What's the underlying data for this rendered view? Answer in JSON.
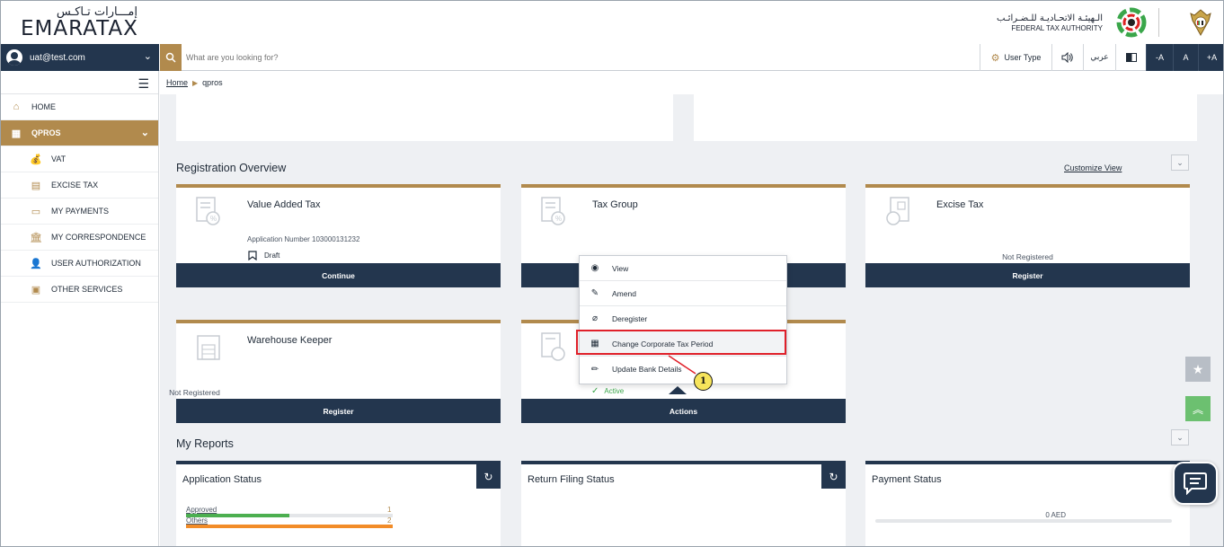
{
  "header": {
    "logo_ar": "إمـــارات تـاكـس",
    "logo_en": "EMARATAX",
    "fta_ar": "الـهيئـة الاتحـاديـة للـضـرائـب",
    "fta_en": "FEDERAL TAX AUTHORITY"
  },
  "searchbar": {
    "user_email": "uat@test.com",
    "placeholder": "What are you looking for?",
    "user_type_label": "User Type",
    "arabic_label": "عربي",
    "font_decrease": "-A",
    "font_normal": "A",
    "font_increase": "+A"
  },
  "sidebar": {
    "items": [
      {
        "label": "HOME",
        "icon": "home-icon"
      },
      {
        "label": "QPROS",
        "icon": "grid-icon"
      },
      {
        "label": "VAT",
        "icon": "money-bag-icon"
      },
      {
        "label": "EXCISE TAX",
        "icon": "excise-icon"
      },
      {
        "label": "MY PAYMENTS",
        "icon": "payments-icon"
      },
      {
        "label": "MY CORRESPONDENCE",
        "icon": "bank-icon"
      },
      {
        "label": "USER AUTHORIZATION",
        "icon": "user-auth-icon"
      },
      {
        "label": "OTHER SERVICES",
        "icon": "document-icon"
      }
    ]
  },
  "breadcrumb": {
    "home": "Home",
    "current": "qpros"
  },
  "registration": {
    "heading": "Registration Overview",
    "customize": "Customize View",
    "cards": [
      {
        "title": "Value Added Tax",
        "app_number": "Application Number 103000131232",
        "status": "Draft",
        "button": "Continue"
      },
      {
        "title": "Tax Group",
        "status": "",
        "button": ""
      },
      {
        "title": "Excise Tax",
        "status": "Not Registered",
        "button": "Register"
      },
      {
        "title": "Warehouse Keeper",
        "status": "Not Registered",
        "button": "Register"
      },
      {
        "title": "",
        "status": "Active",
        "button": "Actions"
      }
    ]
  },
  "actions_menu": {
    "items": [
      {
        "label": "View",
        "icon": "eye-icon"
      },
      {
        "label": "Amend",
        "icon": "pencil-box-icon"
      },
      {
        "label": "Deregister",
        "icon": "deregister-icon"
      },
      {
        "label": "Change Corporate Tax Period",
        "icon": "calendar-icon"
      },
      {
        "label": "Update Bank Details",
        "icon": "pencil-icon"
      }
    ],
    "callout": "1"
  },
  "reports": {
    "heading": "My Reports",
    "cards": [
      {
        "title": "Application Status"
      },
      {
        "title": "Return Filing Status"
      },
      {
        "title": "Payment Status"
      }
    ],
    "application_status": {
      "rows": [
        {
          "label": "Approved",
          "value": "1",
          "fraction": 0.5,
          "color": "#4caf50"
        },
        {
          "label": "Others",
          "value": "2",
          "fraction": 1.0,
          "color": "#f28c28"
        }
      ]
    },
    "payment_amount": "0 AED"
  },
  "colors": {
    "navy": "#23364e",
    "gold": "#b18a4d",
    "highlight_red": "#e0202a",
    "green": "#6cc070"
  }
}
